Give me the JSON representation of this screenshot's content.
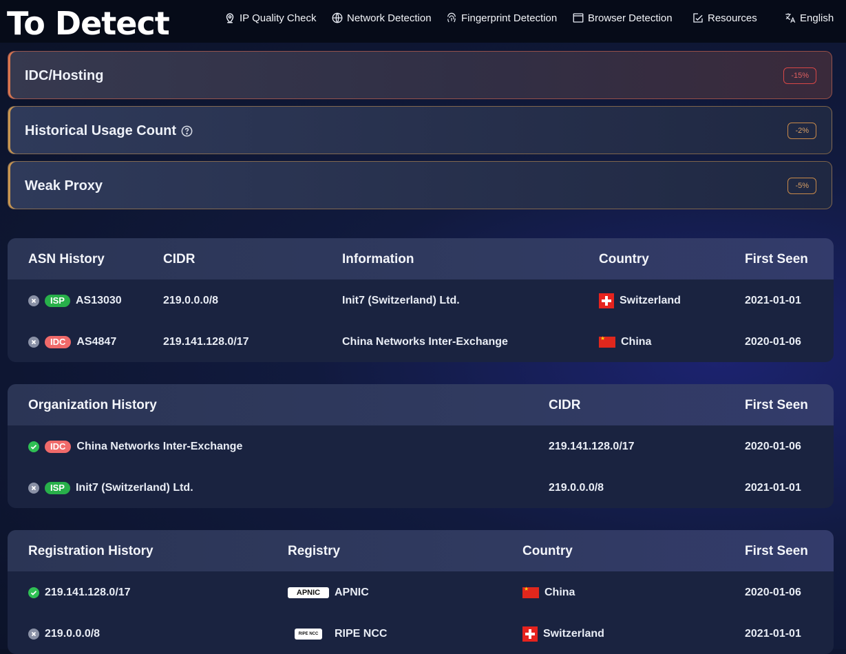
{
  "header": {
    "logo_text": "To Detect",
    "nav": [
      {
        "label": "IP Quality Check",
        "icon": "location-pin-icon"
      },
      {
        "label": "Network Detection",
        "icon": "globe-icon"
      },
      {
        "label": "Fingerprint Detection",
        "icon": "fingerprint-icon"
      },
      {
        "label": "Browser Detection",
        "icon": "browser-window-icon"
      },
      {
        "label": "Resources",
        "icon": "edit-document-icon"
      },
      {
        "label": "English",
        "icon": "translate-icon"
      }
    ]
  },
  "risk_cards": [
    {
      "title": "IDC/Hosting",
      "percent": "-15%",
      "color": "#d94747"
    },
    {
      "title": "Historical Usage Count",
      "percent": "-2%",
      "color": "#c98a4a",
      "help_icon": "question-circle-icon"
    },
    {
      "title": "Weak Proxy",
      "percent": "-5%",
      "color": "#c98a4a"
    }
  ],
  "asn_history": {
    "headers": [
      "ASN History",
      "CIDR",
      "Information",
      "Country",
      "First Seen"
    ],
    "rows": [
      {
        "status": "inactive",
        "tag": "ISP",
        "asn": "AS13030",
        "cidr": "219.0.0.0/8",
        "info": "Init7 (Switzerland) Ltd.",
        "flag": "switzerland-flag-icon",
        "country": "Switzerland",
        "first_seen": "2021-01-01"
      },
      {
        "status": "inactive",
        "tag": "IDC",
        "asn": "AS4847",
        "cidr": "219.141.128.0/17",
        "info": "China Networks Inter-Exchange",
        "flag": "china-flag-icon",
        "country": "China",
        "first_seen": "2020-01-06"
      }
    ]
  },
  "org_history": {
    "headers": [
      "Organization History",
      "CIDR",
      "First Seen"
    ],
    "rows": [
      {
        "status": "active",
        "tag": "IDC",
        "org": "China Networks Inter-Exchange",
        "cidr": "219.141.128.0/17",
        "first_seen": "2020-01-06"
      },
      {
        "status": "inactive",
        "tag": "ISP",
        "org": "Init7 (Switzerland) Ltd.",
        "cidr": "219.0.0.0/8",
        "first_seen": "2021-01-01"
      }
    ]
  },
  "reg_history": {
    "headers": [
      "Registration History",
      "Registry",
      "Country",
      "First Seen"
    ],
    "rows": [
      {
        "status": "active",
        "cidr": "219.141.128.0/17",
        "registry_logo": "APNIC",
        "registry": "APNIC",
        "flag": "china-flag-icon",
        "country": "China",
        "first_seen": "2020-01-06"
      },
      {
        "status": "inactive",
        "cidr": "219.0.0.0/8",
        "registry_logo": "RIPE NCC",
        "registry": "RIPE NCC",
        "flag": "switzerland-flag-icon",
        "country": "Switzerland",
        "first_seen": "2021-01-01"
      }
    ]
  }
}
